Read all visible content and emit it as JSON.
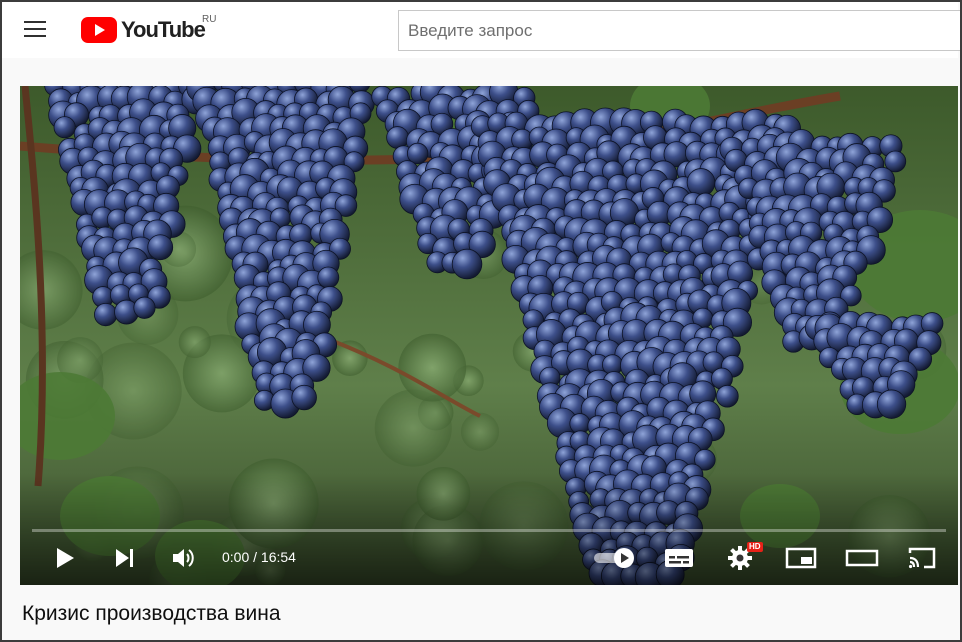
{
  "masthead": {
    "logo_text": "YouTube",
    "country_code": "RU",
    "search_placeholder": "Введите запрос",
    "brand_color": "#ff0000"
  },
  "player": {
    "time_display": "0:00 / 16:54",
    "progress_fraction": 0,
    "hd_badge": "HD",
    "controls": [
      "play-icon",
      "next-icon",
      "volume-icon",
      "autoplay-toggle",
      "subtitles-icon",
      "settings-icon",
      "miniplayer-icon",
      "theater-icon",
      "cast-icon"
    ]
  },
  "video": {
    "title": "Кризис производства вина"
  }
}
